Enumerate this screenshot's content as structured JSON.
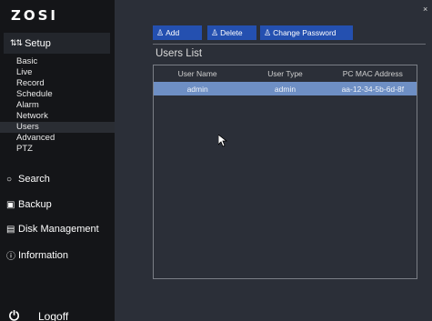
{
  "brand": {
    "logo": "ZOSI"
  },
  "sidebar": {
    "setup": {
      "label": "Setup",
      "icon": "sliders-icon"
    },
    "subitems": [
      {
        "label": "Basic"
      },
      {
        "label": "Live"
      },
      {
        "label": "Record"
      },
      {
        "label": "Schedule"
      },
      {
        "label": "Alarm"
      },
      {
        "label": "Network"
      },
      {
        "label": "Users",
        "active": true
      },
      {
        "label": "Advanced"
      },
      {
        "label": "PTZ"
      }
    ],
    "search": {
      "label": "Search",
      "icon": "magnifier-icon"
    },
    "backup": {
      "label": "Backup",
      "icon": "backup-icon"
    },
    "disk": {
      "label": "Disk Management",
      "icon": "disk-icon"
    },
    "info": {
      "label": "Information",
      "icon": "info-icon"
    },
    "logoff": {
      "label": "Logoff",
      "icon": "power-icon"
    }
  },
  "toolbar": {
    "add": "Add",
    "delete": "Delete",
    "change_password": "Change Password"
  },
  "section": {
    "title": "Users List"
  },
  "table": {
    "headers": [
      "User Name",
      "User Type",
      "PC MAC Address"
    ],
    "rows": [
      {
        "cells": [
          "admin",
          "admin",
          "aa-12-34-5b-6d-8f"
        ],
        "selected": true
      }
    ]
  },
  "window": {
    "close_glyph": "×"
  }
}
